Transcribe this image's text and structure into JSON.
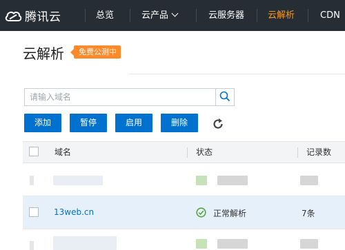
{
  "brand": {
    "name": "腾讯云",
    "icon": "cloud-logo-icon"
  },
  "nav": {
    "overview": "总览",
    "products": "云产品",
    "servers": "云服务器",
    "dns": "云解析",
    "cdn": "CDN",
    "active": "云解析",
    "active_color": "#f59a23"
  },
  "page": {
    "title": "云解析",
    "badge": "免费公测中",
    "badge_color": "#ff8a2b"
  },
  "search": {
    "placeholder": "请输入域名",
    "value": "",
    "icon": "search-icon"
  },
  "toolbar": {
    "add": "添加",
    "pause": "暂停",
    "enable": "启用",
    "delete": "删除",
    "refresh_icon": "refresh-icon",
    "button_color": "#0071ce"
  },
  "table": {
    "headers": {
      "domain": "域名",
      "status": "状态",
      "records": "记录数"
    },
    "rows": [
      {
        "domain": "",
        "status": "",
        "records": "",
        "obscured": true
      },
      {
        "domain": "13web.cn",
        "status": "正常解析",
        "status_icon": "check-circle-icon",
        "status_color": "#52a83a",
        "records": "7条",
        "selected": true
      },
      {
        "domain": "",
        "status": "",
        "records": "",
        "obscured": true
      }
    ]
  }
}
